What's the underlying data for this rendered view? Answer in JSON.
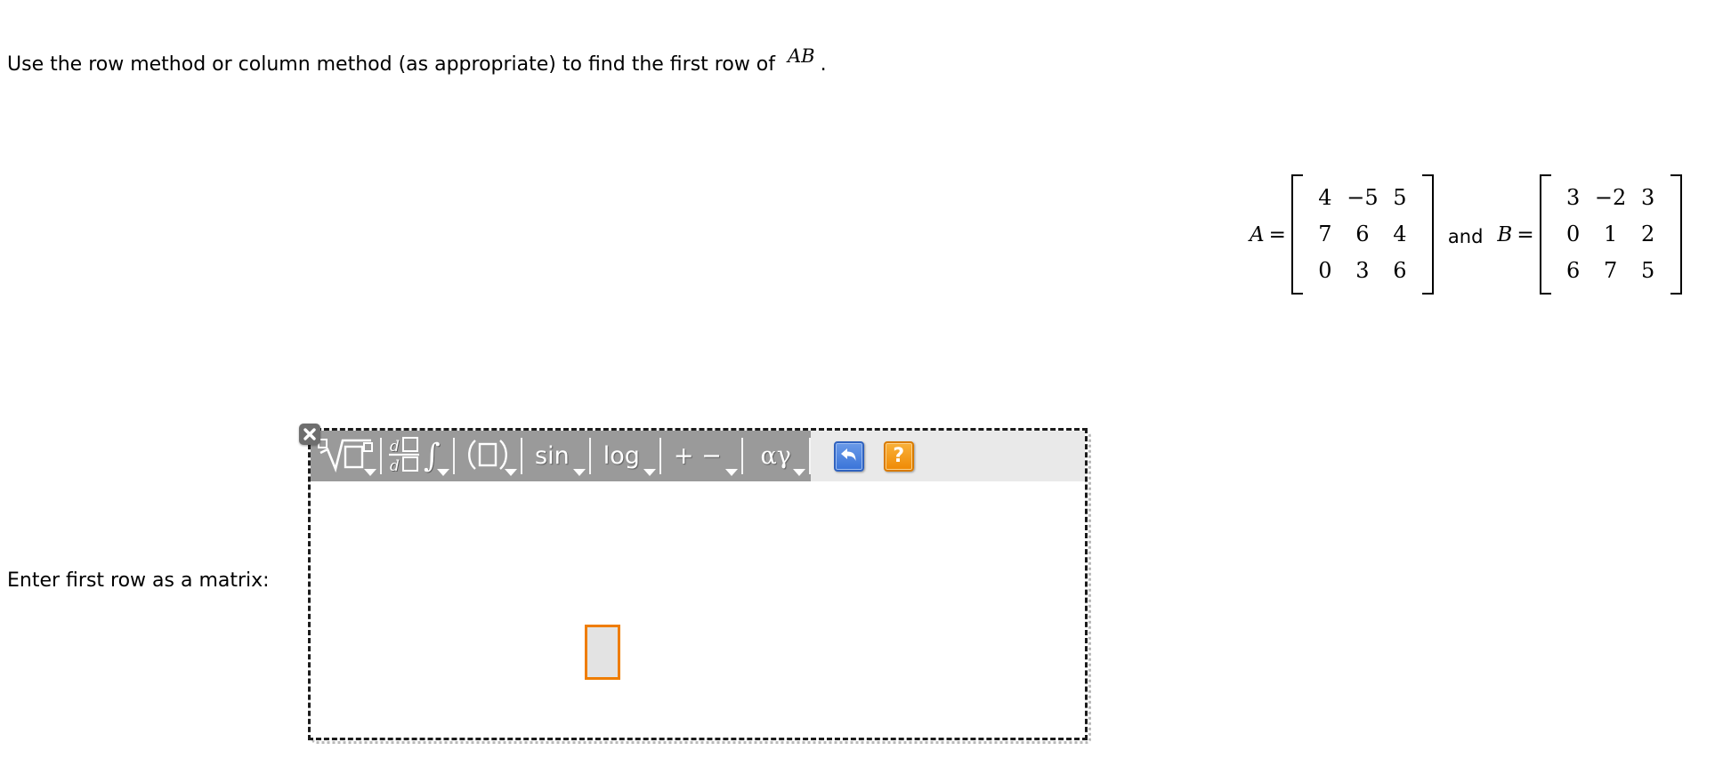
{
  "question": {
    "text_before": "Use the row method or column method (as appropriate) to find the first row of",
    "math": "AB",
    "text_after": "."
  },
  "matrices": {
    "a_label": "A",
    "a_equals": "=",
    "a_values": [
      [
        "4",
        "−5",
        "5"
      ],
      [
        "7",
        "6",
        "4"
      ],
      [
        "0",
        "3",
        "6"
      ]
    ],
    "conjunction": "and",
    "b_label": "B",
    "b_equals": "=",
    "b_values": [
      [
        "3",
        "−2",
        "3"
      ],
      [
        "0",
        "1",
        "2"
      ],
      [
        "6",
        "7",
        "5"
      ]
    ]
  },
  "answer": {
    "label": "Enter first row as a matrix:"
  },
  "editor": {
    "close_label": "✕",
    "toolbar": {
      "buttons": [
        {
          "name": "radical",
          "glyph": "√",
          "has_dropdown": true
        },
        {
          "name": "calculus",
          "glyph": "d∕d ∫",
          "has_dropdown": true
        },
        {
          "name": "parentheses",
          "glyph": "(□)",
          "has_dropdown": true
        },
        {
          "name": "trig",
          "glyph": "sin",
          "has_dropdown": true
        },
        {
          "name": "log",
          "glyph": "log",
          "has_dropdown": true
        },
        {
          "name": "operators",
          "glyph": "+ −",
          "has_dropdown": true
        },
        {
          "name": "greek",
          "glyph": "αγ",
          "has_dropdown": true
        }
      ],
      "undo_label": "↩",
      "help_label": "?"
    },
    "canvas": {
      "cursor_placeholder": ""
    }
  },
  "colors": {
    "toolbar_bg": "#9a9a9a",
    "toolbar_right_bg": "#e9e9e9",
    "cursor_border": "#ef7d00",
    "cursor_fill": "#e3e3e3",
    "undo_blue": "#3a74d8",
    "help_orange": "#ef8a05",
    "close_gray": "#6e6e6e"
  }
}
